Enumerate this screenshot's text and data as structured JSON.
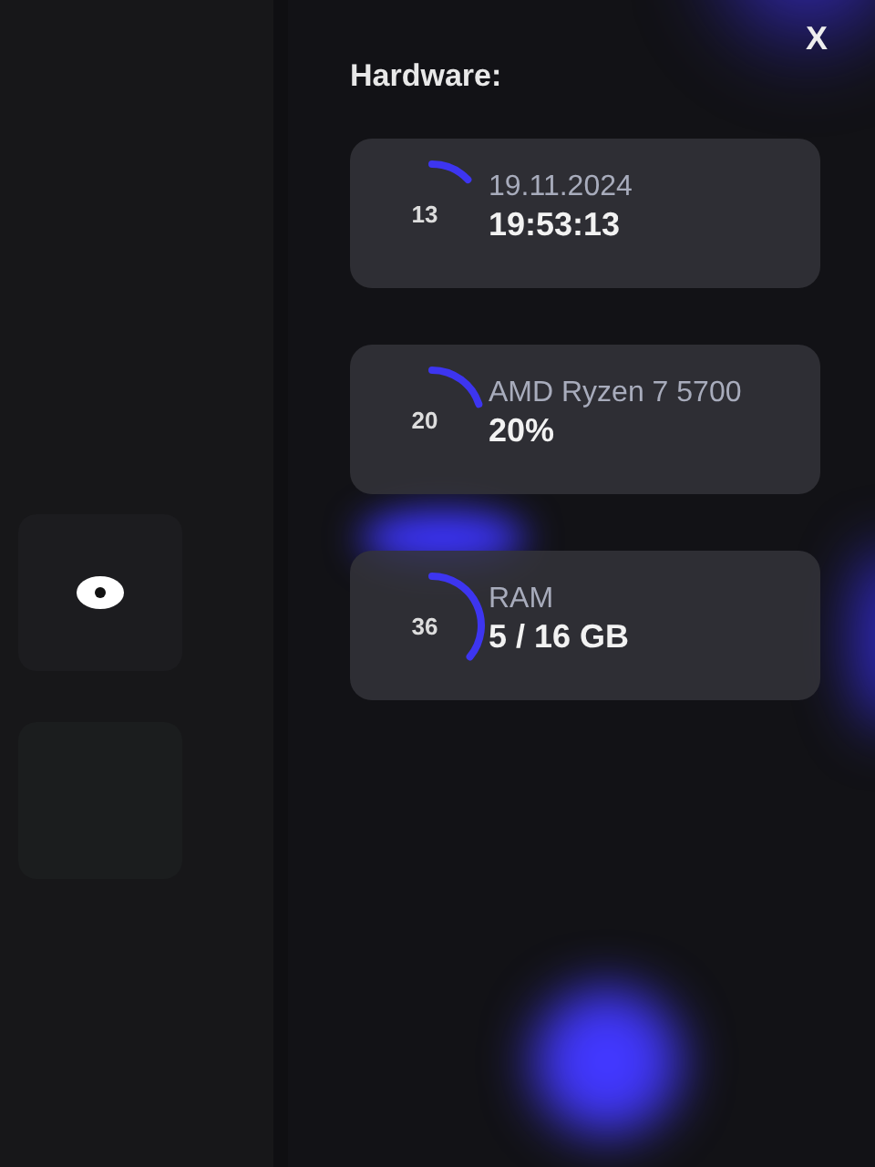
{
  "close_button": "X",
  "title": "Hardware:",
  "cards": [
    {
      "gauge_value": "13",
      "label": "19.11.2024",
      "value": "19:53:13"
    },
    {
      "gauge_value": "20",
      "label": "AMD Ryzen 7 5700",
      "value": "20%"
    },
    {
      "gauge_value": "36",
      "label": "RAM",
      "value": "5 / 16 GB"
    }
  ],
  "sidebar": {
    "tiles": [
      {
        "kind": "eye"
      },
      {
        "kind": "empty"
      }
    ]
  }
}
